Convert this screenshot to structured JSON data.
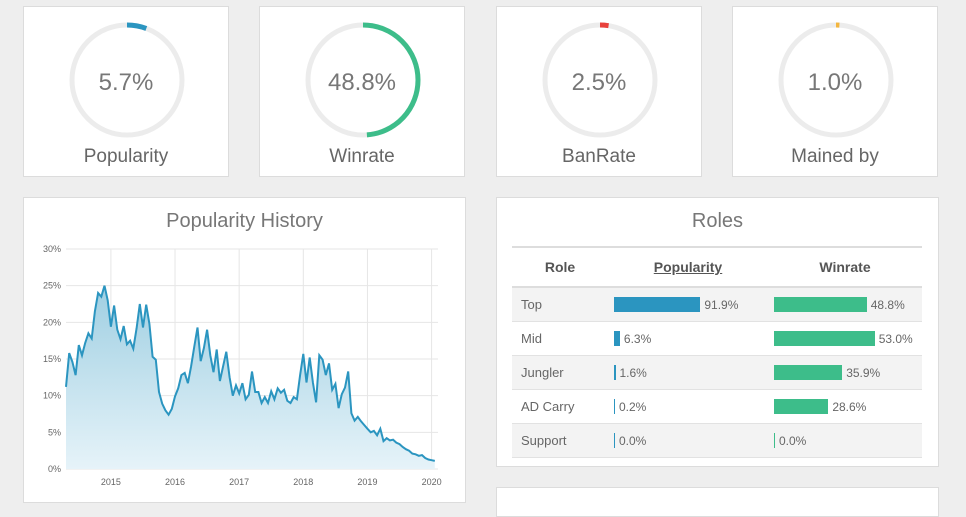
{
  "stats": [
    {
      "value": "5.7%",
      "label": "Popularity",
      "fraction": 0.057,
      "color": "#2b95c0"
    },
    {
      "value": "48.8%",
      "label": "Winrate",
      "fraction": 0.488,
      "color": "#3dbd8a"
    },
    {
      "value": "2.5%",
      "label": "BanRate",
      "fraction": 0.025,
      "color": "#e8413c"
    },
    {
      "value": "1.0%",
      "label": "Mained by",
      "fraction": 0.01,
      "color": "#f3b63f"
    }
  ],
  "history": {
    "title": "Popularity History"
  },
  "roles": {
    "title": "Roles",
    "headers": {
      "role": "Role",
      "popularity": "Popularity",
      "winrate": "Winrate"
    },
    "rows": [
      {
        "role": "Top",
        "popularity": "91.9%",
        "pop_value": 91.9,
        "winrate": "48.8%",
        "win_value": 48.8
      },
      {
        "role": "Mid",
        "popularity": "6.3%",
        "pop_value": 6.3,
        "winrate": "53.0%",
        "win_value": 53.0
      },
      {
        "role": "Jungler",
        "popularity": "1.6%",
        "pop_value": 1.6,
        "winrate": "35.9%",
        "win_value": 35.9
      },
      {
        "role": "AD Carry",
        "popularity": "0.2%",
        "pop_value": 0.2,
        "winrate": "28.6%",
        "win_value": 28.6
      },
      {
        "role": "Support",
        "popularity": "0.0%",
        "pop_value": 0.0,
        "winrate": "0.0%",
        "win_value": 0.0
      }
    ]
  },
  "chart_data": {
    "type": "area",
    "title": "Popularity History",
    "xlabel": "",
    "ylabel": "",
    "ylim": [
      0,
      30
    ],
    "xlim": [
      2014.3,
      2020.1
    ],
    "yticks": [
      "0%",
      "5%",
      "10%",
      "15%",
      "20%",
      "25%",
      "30%"
    ],
    "xticks": [
      "2015",
      "2016",
      "2017",
      "2018",
      "2019",
      "2020"
    ],
    "grid": true,
    "color": "#2b95c0",
    "series": [
      {
        "x": [
          2014.3,
          2014.35,
          2014.4,
          2014.45,
          2014.5,
          2014.55,
          2014.6,
          2014.65,
          2014.7,
          2014.75,
          2014.8,
          2014.85,
          2014.9,
          2014.95,
          2015.0,
          2015.05,
          2015.1,
          2015.15,
          2015.2,
          2015.25,
          2015.3,
          2015.35,
          2015.4,
          2015.45,
          2015.5,
          2015.55,
          2015.6,
          2015.65,
          2015.7,
          2015.75,
          2015.8,
          2015.85,
          2015.9,
          2015.95,
          2016.0,
          2016.05,
          2016.1,
          2016.15,
          2016.2,
          2016.25,
          2016.3,
          2016.35,
          2016.4,
          2016.45,
          2016.5,
          2016.55,
          2016.6,
          2016.65,
          2016.7,
          2016.75,
          2016.8,
          2016.85,
          2016.9,
          2016.95,
          2017.0,
          2017.05,
          2017.1,
          2017.15,
          2017.2,
          2017.25,
          2017.3,
          2017.35,
          2017.4,
          2017.45,
          2017.5,
          2017.55,
          2017.6,
          2017.65,
          2017.7,
          2017.75,
          2017.8,
          2017.85,
          2017.9,
          2017.95,
          2018.0,
          2018.05,
          2018.1,
          2018.15,
          2018.2,
          2018.25,
          2018.3,
          2018.35,
          2018.4,
          2018.45,
          2018.5,
          2018.55,
          2018.6,
          2018.65,
          2018.7,
          2018.75,
          2018.8,
          2018.85,
          2018.9,
          2018.95,
          2019.0,
          2019.05,
          2019.1,
          2019.15,
          2019.2,
          2019.25,
          2019.3,
          2019.35,
          2019.4,
          2019.45,
          2019.5,
          2019.55,
          2019.6,
          2019.65,
          2019.7,
          2019.75,
          2019.8,
          2019.85,
          2019.9,
          2019.95,
          2020.0,
          2020.05
        ],
        "values": [
          11.2,
          15.8,
          14.6,
          12.8,
          16.9,
          15.5,
          17.2,
          18.5,
          17.8,
          21.5,
          24.0,
          23.5,
          25.0,
          23.0,
          19.4,
          22.3,
          19.0,
          17.7,
          19.5,
          17.0,
          17.5,
          16.4,
          19.2,
          22.5,
          19.3,
          22.4,
          19.8,
          15.3,
          14.9,
          10.5,
          8.9,
          8.0,
          7.4,
          8.2,
          9.9,
          11.0,
          12.8,
          13.1,
          11.7,
          14.0,
          16.7,
          19.3,
          14.7,
          16.5,
          19.0,
          15.5,
          13.2,
          16.3,
          12.0,
          14.0,
          16.0,
          12.5,
          10.0,
          11.4,
          10.3,
          11.7,
          9.5,
          10.1,
          13.3,
          10.5,
          10.5,
          9.0,
          9.8,
          9.0,
          10.6,
          9.5,
          11.0,
          10.4,
          10.8,
          9.3,
          9.0,
          9.8,
          9.5,
          12.8,
          15.7,
          11.8,
          15.2,
          11.8,
          9.1,
          15.5,
          14.9,
          12.8,
          14.4,
          10.8,
          11.6,
          8.3,
          10.2,
          11.1,
          13.3,
          7.6,
          6.6,
          7.1,
          6.5,
          6.0,
          5.5,
          5.0,
          5.2,
          4.6,
          5.5,
          3.8,
          4.2,
          3.9,
          4.0,
          3.6,
          3.4,
          3.0,
          2.7,
          2.5,
          2.1,
          2.0,
          1.8,
          1.9,
          1.5,
          1.3,
          1.2,
          1.1
        ]
      }
    ]
  }
}
